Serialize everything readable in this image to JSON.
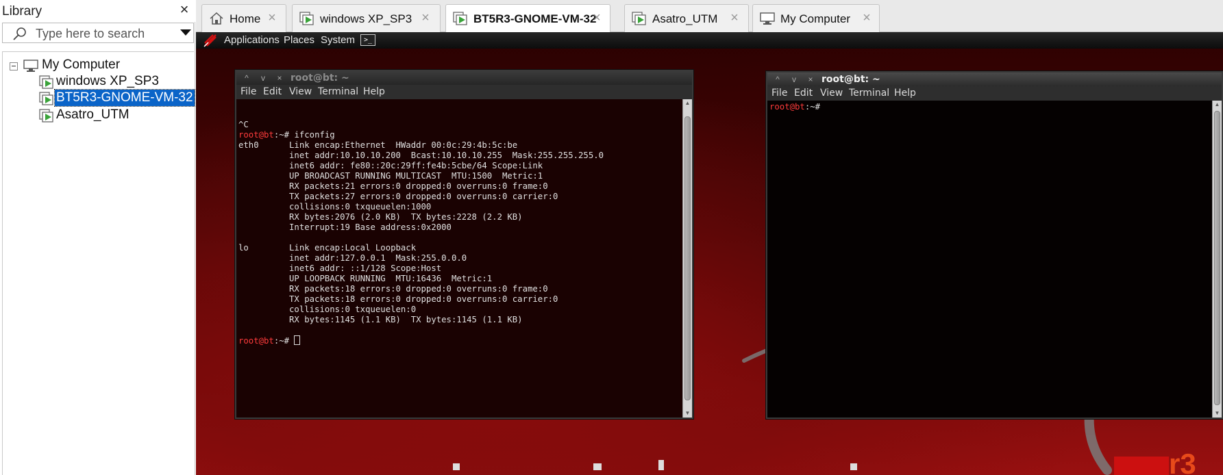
{
  "library": {
    "title": "Library",
    "search_placeholder": "Type here to search",
    "tree": {
      "root": "My Computer",
      "vms": [
        "windows XP_SP3",
        "BT5R3-GNOME-VM-32",
        "Asatro_UTM"
      ]
    }
  },
  "tabs": [
    {
      "label": "Home",
      "icon": "home-icon"
    },
    {
      "label": "windows XP_SP3",
      "icon": "vm-icon"
    },
    {
      "label": "BT5R3-GNOME-VM-32",
      "icon": "vm-icon",
      "active": true
    },
    {
      "label": "Asatro_UTM",
      "icon": "vm-icon"
    },
    {
      "label": "My Computer",
      "icon": "computer-icon"
    }
  ],
  "gnome_panel": {
    "menus": [
      "Applications",
      "Places",
      "System"
    ],
    "launcher": ">_"
  },
  "terminal_left": {
    "title": "root@bt: ~",
    "menus": [
      "File",
      "Edit",
      "View",
      "Terminal",
      "Help"
    ],
    "prompt": "root@bt",
    "prompt_suffix": ":~# ",
    "lines": [
      "",
      "",
      "^C",
      "@@PROMPT@@ifconfig",
      "eth0      Link encap:Ethernet  HWaddr 00:0c:29:4b:5c:be",
      "          inet addr:10.10.10.200  Bcast:10.10.10.255  Mask:255.255.255.0",
      "          inet6 addr: fe80::20c:29ff:fe4b:5cbe/64 Scope:Link",
      "          UP BROADCAST RUNNING MULTICAST  MTU:1500  Metric:1",
      "          RX packets:21 errors:0 dropped:0 overruns:0 frame:0",
      "          TX packets:27 errors:0 dropped:0 overruns:0 carrier:0",
      "          collisions:0 txqueuelen:1000",
      "          RX bytes:2076 (2.0 KB)  TX bytes:2228 (2.2 KB)",
      "          Interrupt:19 Base address:0x2000",
      "",
      "lo        Link encap:Local Loopback",
      "          inet addr:127.0.0.1  Mask:255.0.0.0",
      "          inet6 addr: ::1/128 Scope:Host",
      "          UP LOOPBACK RUNNING  MTU:16436  Metric:1",
      "          RX packets:18 errors:0 dropped:0 overruns:0 frame:0",
      "          TX packets:18 errors:0 dropped:0 overruns:0 carrier:0",
      "          collisions:0 txqueuelen:0",
      "          RX bytes:1145 (1.1 KB)  TX bytes:1145 (1.1 KB)",
      "",
      "@@PROMPT@@@@CURSOR@@"
    ]
  },
  "terminal_right": {
    "title": "root@bt: ~",
    "menus": [
      "File",
      "Edit",
      "View",
      "Terminal",
      "Help"
    ],
    "prompt": "root@bt",
    "prompt_suffix": ":~#"
  },
  "colors": {
    "prompt": "#ff3b3b",
    "selection": "#0a64c8",
    "vm_play_green": "#3aa33a"
  }
}
